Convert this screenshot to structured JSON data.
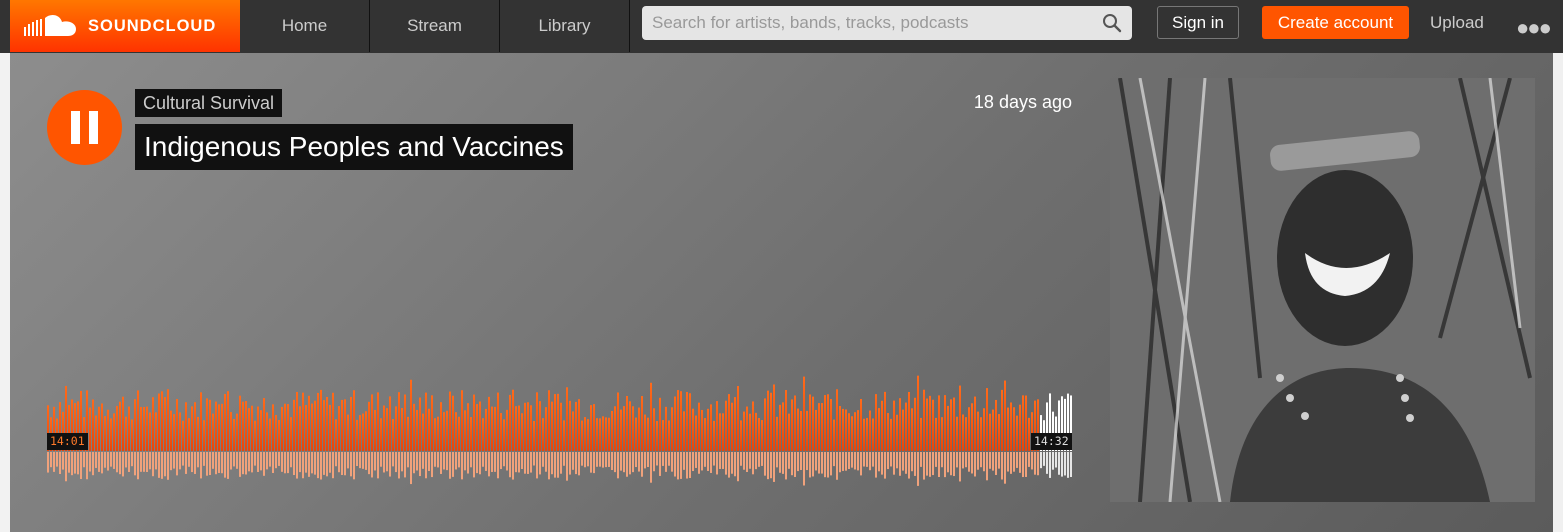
{
  "header": {
    "logo_text": "SOUNDCLOUD",
    "nav": [
      "Home",
      "Stream",
      "Library"
    ],
    "search_placeholder": "Search for artists, bands, tracks, podcasts",
    "sign_in": "Sign in",
    "create_account": "Create account",
    "upload": "Upload",
    "brand_color": "#ff5500"
  },
  "track": {
    "artist": "Cultural Survival",
    "title": "Indigenous Peoples and Vaccines",
    "posted": "18 days ago",
    "time_elapsed": "14:01",
    "duration": "14:32",
    "progress": 0.965,
    "state": "playing"
  },
  "icons": {
    "logo": "soundcloud-cloud-icon",
    "search": "search-icon",
    "more": "more-dots-icon",
    "play": "pause-icon"
  }
}
